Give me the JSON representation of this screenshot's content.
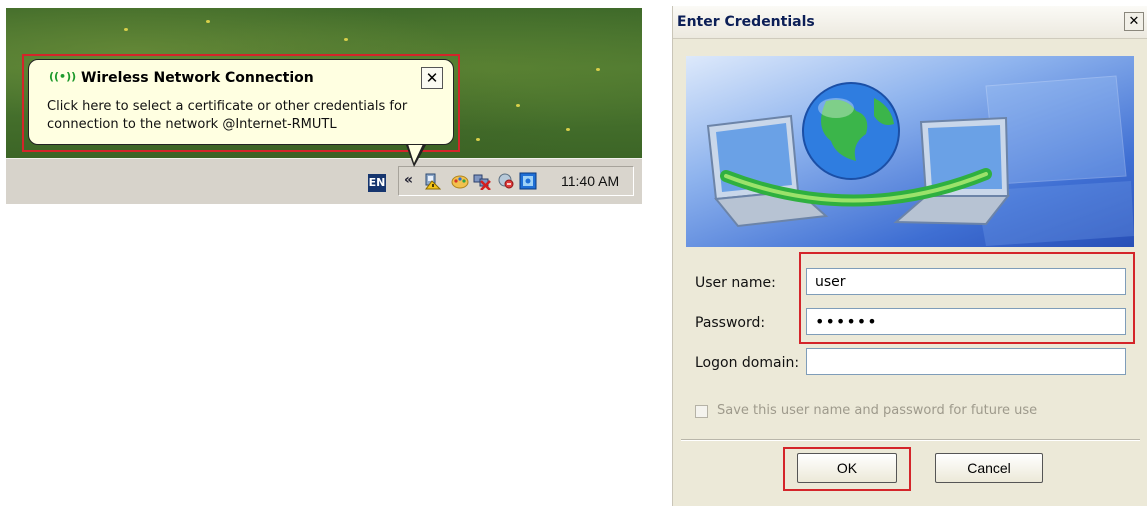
{
  "taskbar": {
    "language": "EN",
    "expand_glyph": "«",
    "clock": "11:40 AM",
    "tray_icons": [
      "network-warning-icon",
      "paint-icon",
      "network-disconnected-icon",
      "messenger-icon",
      "app-icon"
    ]
  },
  "balloon": {
    "icon": "wireless-signal-icon",
    "icon_glyph": "((•))",
    "title": "Wireless Network Connection",
    "close_glyph": "✕",
    "message": "Click here to select a certificate or other credentials for connection to the network @Internet-RMUTL"
  },
  "dialog": {
    "title": "Enter Credentials",
    "close_glyph": "✕",
    "fields": {
      "username_label": "User name:",
      "username_value": "user",
      "password_label": "Password:",
      "password_value": "••••••",
      "domain_label": "Logon domain:",
      "domain_value": ""
    },
    "save_label": "Save this user name and password for future use",
    "ok_label": "OK",
    "cancel_label": "Cancel"
  },
  "colors": {
    "highlight": "#d4252a",
    "balloon_bg": "#ffffe1",
    "dialog_bg": "#ece9d8"
  }
}
